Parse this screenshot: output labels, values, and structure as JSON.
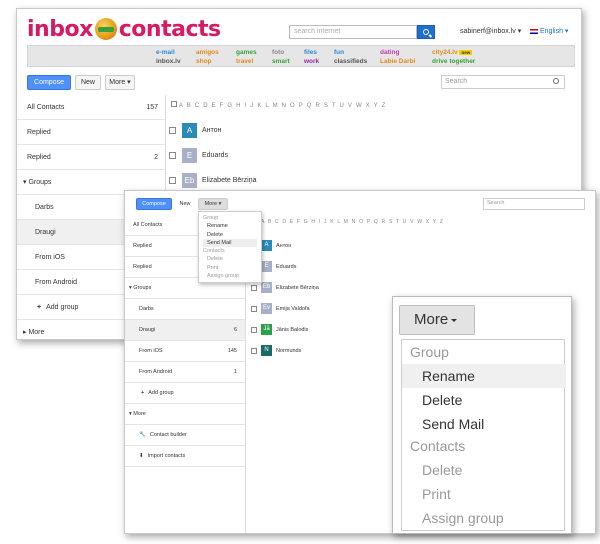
{
  "brand": {
    "left": "inbox",
    "right": "contacts"
  },
  "header": {
    "search_placeholder": "search internet",
    "user": "sabinerf@inbox.lv ▾",
    "language": "English ▾"
  },
  "nav": [
    {
      "top": "e-mail",
      "bottom": "inbox.lv",
      "top_color": "#2a8ad8",
      "bottom_color": "#555555"
    },
    {
      "top": "amigos",
      "bottom": "shop",
      "top_color": "#e38a1a",
      "bottom_color": "#e38a1a"
    },
    {
      "top": "games",
      "bottom": "travel",
      "top_color": "#3a9f3a",
      "bottom_color": "#e38a1a"
    },
    {
      "top": "foto",
      "bottom": "smart",
      "top_color": "#888888",
      "bottom_color": "#3a9f3a"
    },
    {
      "top": "files",
      "bottom": "work",
      "top_color": "#2a8ad8",
      "bottom_color": "#8a2aa8"
    },
    {
      "top": "fun",
      "bottom": "classifieds",
      "top_color": "#2a8ad8",
      "bottom_color": "#555555"
    },
    {
      "top": "dating",
      "bottom": "Labie Darbi",
      "top_color": "#c43aa8",
      "bottom_color": "#e38a1a"
    },
    {
      "top": "city24.lv",
      "bottom": "drive together",
      "top_color": "#e38a1a",
      "bottom_color": "#3a9f3a",
      "badge": "new"
    }
  ],
  "toolbar": {
    "compose": "Compose",
    "new": "New",
    "more": "More ▾",
    "search_placeholder": "Search"
  },
  "sidebar": {
    "all_contacts": {
      "label": "All Contacts",
      "count": "157"
    },
    "replied1": {
      "label": "Replied",
      "count": ""
    },
    "replied2": {
      "label": "Replied",
      "count": "2"
    },
    "groups": "▾ Groups",
    "items": [
      {
        "label": "Darbs",
        "count": ""
      },
      {
        "label": "Draugi",
        "count": "6"
      },
      {
        "label": "From iOS",
        "count": "145"
      },
      {
        "label": "From Android",
        "count": "1"
      }
    ],
    "add_group": "Add group",
    "more": "▸ More",
    "more_open": "▾ More",
    "contact_builder": "Contact builder",
    "import_contacts": "Import contacts"
  },
  "alphabet": "A B C D E F G H I J K L M N O P Q R S T U V W X Y Z",
  "contacts": [
    {
      "initials": "A",
      "name": "Антон",
      "color": "#2a8ab8"
    },
    {
      "initials": "E",
      "name": "Eduards",
      "color": "#a7b0c7"
    },
    {
      "initials": "Eb",
      "name": "Elizabete Bērziņa",
      "color": "#a7b0c7"
    },
    {
      "initials": "Ev",
      "name": "Emija Valdofa",
      "color": "#a7b0c7"
    },
    {
      "initials": "Jā",
      "name": "Jānis Balodis",
      "color": "#2aa04a"
    },
    {
      "initials": "N",
      "name": "Normunds",
      "color": "#1a6a6a"
    }
  ],
  "more_menu": {
    "button": "More",
    "group_header": "Group",
    "group_items": [
      "Rename",
      "Delete",
      "Send Mail"
    ],
    "contacts_header": "Contacts",
    "contacts_items": [
      "Delete",
      "Print",
      "Assign group"
    ]
  }
}
